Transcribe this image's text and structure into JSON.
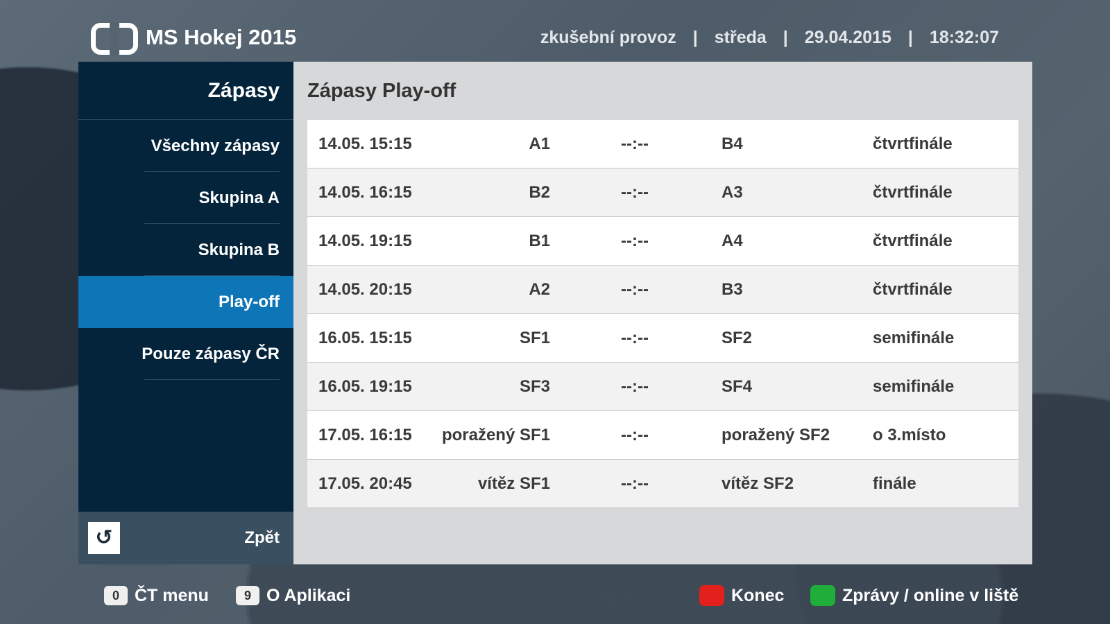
{
  "header": {
    "app_title": "MS Hokej 2015",
    "status_mode": "zkušební provoz",
    "day": "středa",
    "date": "29.04.2015",
    "time": "18:32:07",
    "separator": "|"
  },
  "sidebar": {
    "title": "Zápasy",
    "items": [
      {
        "label": "Všechny zápasy"
      },
      {
        "label": "Skupina A"
      },
      {
        "label": "Skupina B"
      },
      {
        "label": "Play-off",
        "active": true
      },
      {
        "label": "Pouze zápasy ČR"
      }
    ],
    "back_label": "Zpět",
    "back_icon": "undo-arrow-icon"
  },
  "panel": {
    "title": "Zápasy Play-off",
    "rows": [
      {
        "time": "14.05. 15:15",
        "home": "A1",
        "score": "--:--",
        "away": "B4",
        "stage": "čtvrtfinále"
      },
      {
        "time": "14.05. 16:15",
        "home": "B2",
        "score": "--:--",
        "away": "A3",
        "stage": "čtvrtfinále"
      },
      {
        "time": "14.05. 19:15",
        "home": "B1",
        "score": "--:--",
        "away": "A4",
        "stage": "čtvrtfinále"
      },
      {
        "time": "14.05. 20:15",
        "home": "A2",
        "score": "--:--",
        "away": "B3",
        "stage": "čtvrtfinále"
      },
      {
        "time": "16.05. 15:15",
        "home": "SF1",
        "score": "--:--",
        "away": "SF2",
        "stage": "semifinále"
      },
      {
        "time": "16.05. 19:15",
        "home": "SF3",
        "score": "--:--",
        "away": "SF4",
        "stage": "semifinále"
      },
      {
        "time": "17.05. 16:15",
        "home": "poražený SF1",
        "score": "--:--",
        "away": "poražený SF2",
        "stage": "o 3.místo"
      },
      {
        "time": "17.05. 20:45",
        "home": "vítěz SF1",
        "score": "--:--",
        "away": "vítěz SF2",
        "stage": "finále"
      }
    ]
  },
  "footer": {
    "menu_key": "0",
    "menu_label": "ČT menu",
    "app_key": "9",
    "app_label": "O Aplikaci",
    "red_label": "Konec",
    "green_label": "Zprávy / online v liště",
    "red_color": "#e3201b",
    "green_color": "#1fae3a"
  },
  "colors": {
    "sidebar_bg": "#04243b",
    "active_item": "#0e75b6",
    "panel_bg": "#d7d8d9"
  }
}
